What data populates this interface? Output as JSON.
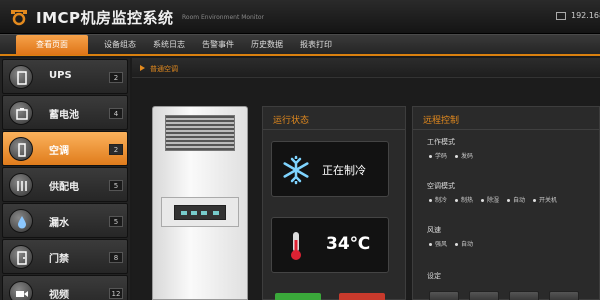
{
  "header": {
    "title": "IMCP机房监控系统",
    "subtitle": "Room Environment Monitor",
    "ip": "192.168."
  },
  "nav": {
    "items": [
      {
        "label": "查看页面"
      },
      {
        "label": "设备组态"
      },
      {
        "label": "系统日志"
      },
      {
        "label": "告警事件"
      },
      {
        "label": "历史数据"
      },
      {
        "label": "报表打印"
      }
    ]
  },
  "sidebar": {
    "items": [
      {
        "label": "UPS",
        "count": "2",
        "icon": "ups-icon"
      },
      {
        "label": "蓄电池",
        "count": "4",
        "icon": "battery-icon"
      },
      {
        "label": "空调",
        "count": "2",
        "icon": "air-conditioner-icon"
      },
      {
        "label": "供配电",
        "count": "5",
        "icon": "power-distribution-icon"
      },
      {
        "label": "漏水",
        "count": "5",
        "icon": "water-leak-icon"
      },
      {
        "label": "门禁",
        "count": "8",
        "icon": "door-access-icon"
      },
      {
        "label": "视频",
        "count": "12",
        "icon": "video-icon"
      }
    ]
  },
  "breadcrumb": {
    "text": "普通空调"
  },
  "status_panel": {
    "title": "运行状态",
    "mode_status": "正在制冷",
    "temperature": "34℃"
  },
  "control_panel": {
    "title": "远程控制",
    "work_mode": {
      "label": "工作模式",
      "options": [
        "学码",
        "发码"
      ]
    },
    "ac_mode": {
      "label": "空调模式",
      "options": [
        "制冷",
        "制热",
        "除湿",
        "自动",
        "开关机"
      ]
    },
    "wind": {
      "label": "风速",
      "options": [
        "强风",
        "自动"
      ]
    },
    "setting": {
      "label": "设定"
    }
  },
  "colors": {
    "accent": "#e38a1e",
    "active_tab": "#de7417",
    "green": "#3aa83a",
    "red": "#c83a2c"
  }
}
